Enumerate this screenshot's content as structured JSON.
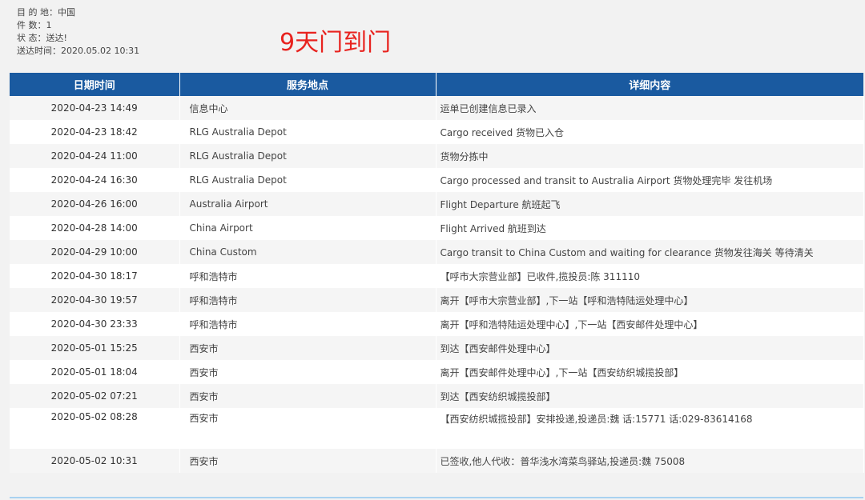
{
  "info": {
    "destination": "目 的 地：中国",
    "pieces": "件 数：1",
    "status": "状 态：送达!",
    "delivered_time": "送达时间：2020.05.02 10:31"
  },
  "headline": "9天门到门",
  "table": {
    "headers": [
      "日期时间",
      "服务地点",
      "详细内容"
    ],
    "rows": [
      {
        "time": "2020-04-23 14:49",
        "place": "信息中心",
        "detail": "运单已创建信息已录入"
      },
      {
        "time": "2020-04-23 18:42",
        "place": "RLG Australia Depot",
        "detail": "Cargo received 货物已入仓"
      },
      {
        "time": "2020-04-24 11:00",
        "place": "RLG Australia Depot",
        "detail": "货物分拣中"
      },
      {
        "time": "2020-04-24 16:30",
        "place": "RLG Australia Depot",
        "detail": "Cargo processed and transit to Australia Airport 货物处理完毕 发往机场"
      },
      {
        "time": "2020-04-26 16:00",
        "place": "Australia Airport",
        "detail": "Flight Departure 航班起飞"
      },
      {
        "time": "2020-04-28 14:00",
        "place": "China Airport",
        "detail": "Flight Arrived 航班到达"
      },
      {
        "time": "2020-04-29 10:00",
        "place": "China Custom",
        "detail": "Cargo transit to China Custom and waiting for clearance 货物发往海关 等待清关"
      },
      {
        "time": "2020-04-30 18:17",
        "place": "呼和浩特市",
        "detail": "【呼市大宗营业部】已收件,揽投员:陈 311110"
      },
      {
        "time": "2020-04-30 19:57",
        "place": "呼和浩特市",
        "detail": "离开【呼市大宗营业部】,下一站【呼和浩特陆运处理中心】"
      },
      {
        "time": "2020-04-30 23:33",
        "place": "呼和浩特市",
        "detail": "离开【呼和浩特陆运处理中心】,下一站【西安邮件处理中心】"
      },
      {
        "time": "2020-05-01 15:25",
        "place": "西安市",
        "detail": "到达【西安邮件处理中心】"
      },
      {
        "time": "2020-05-01 18:04",
        "place": "西安市",
        "detail": "离开【西安邮件处理中心】,下一站【西安纺织城揽投部】"
      },
      {
        "time": "2020-05-02 07:21",
        "place": "西安市",
        "detail": "到达【西安纺织城揽投部】"
      },
      {
        "time": "2020-05-02 08:28",
        "place": "西安市",
        "detail": "【西安纺织城揽投部】安排投递,投递员:魏 话:15771 话:029-83614168"
      },
      {
        "time": "2020-05-02 10:31",
        "place": "西安市",
        "detail": "已签收,他人代收：普华浅水湾菜鸟驿站,投递员:魏 75008"
      }
    ]
  }
}
